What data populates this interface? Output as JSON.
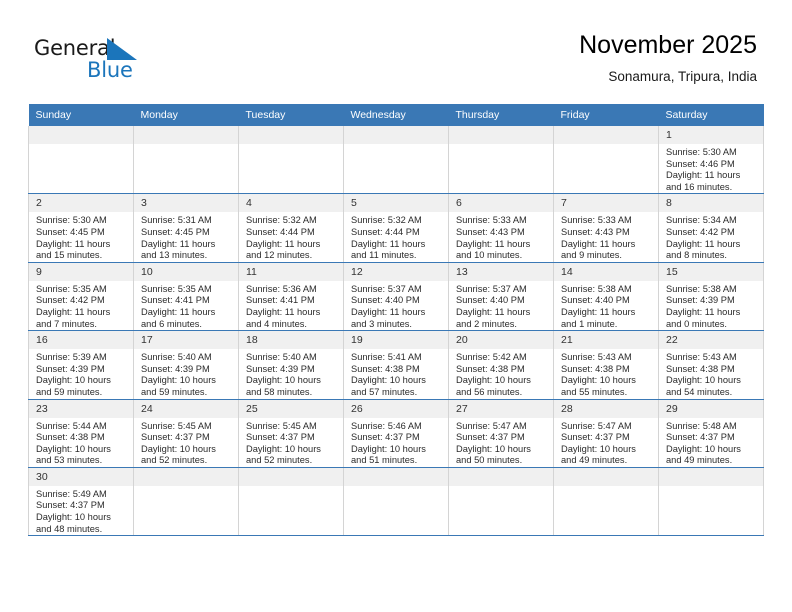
{
  "brand": {
    "name_part1": "General",
    "name_part2": "Blue",
    "logo_color": "#1b75bb"
  },
  "header": {
    "title": "November 2025",
    "subtitle": "Sonamura, Tripura, India"
  },
  "theme": {
    "header_bg": "#3a78b5",
    "daynum_bg": "#f0f0f0",
    "cell_border": "#d4d4d4",
    "text": "#2b2b2b"
  },
  "weekdays": [
    "Sunday",
    "Monday",
    "Tuesday",
    "Wednesday",
    "Thursday",
    "Friday",
    "Saturday"
  ],
  "weeks": [
    [
      {
        "day": "",
        "sunrise": "",
        "sunset": "",
        "daylight1": "",
        "daylight2": ""
      },
      {
        "day": "",
        "sunrise": "",
        "sunset": "",
        "daylight1": "",
        "daylight2": ""
      },
      {
        "day": "",
        "sunrise": "",
        "sunset": "",
        "daylight1": "",
        "daylight2": ""
      },
      {
        "day": "",
        "sunrise": "",
        "sunset": "",
        "daylight1": "",
        "daylight2": ""
      },
      {
        "day": "",
        "sunrise": "",
        "sunset": "",
        "daylight1": "",
        "daylight2": ""
      },
      {
        "day": "",
        "sunrise": "",
        "sunset": "",
        "daylight1": "",
        "daylight2": ""
      },
      {
        "day": "1",
        "sunrise": "Sunrise: 5:30 AM",
        "sunset": "Sunset: 4:46 PM",
        "daylight1": "Daylight: 11 hours",
        "daylight2": "and 16 minutes."
      }
    ],
    [
      {
        "day": "2",
        "sunrise": "Sunrise: 5:30 AM",
        "sunset": "Sunset: 4:45 PM",
        "daylight1": "Daylight: 11 hours",
        "daylight2": "and 15 minutes."
      },
      {
        "day": "3",
        "sunrise": "Sunrise: 5:31 AM",
        "sunset": "Sunset: 4:45 PM",
        "daylight1": "Daylight: 11 hours",
        "daylight2": "and 13 minutes."
      },
      {
        "day": "4",
        "sunrise": "Sunrise: 5:32 AM",
        "sunset": "Sunset: 4:44 PM",
        "daylight1": "Daylight: 11 hours",
        "daylight2": "and 12 minutes."
      },
      {
        "day": "5",
        "sunrise": "Sunrise: 5:32 AM",
        "sunset": "Sunset: 4:44 PM",
        "daylight1": "Daylight: 11 hours",
        "daylight2": "and 11 minutes."
      },
      {
        "day": "6",
        "sunrise": "Sunrise: 5:33 AM",
        "sunset": "Sunset: 4:43 PM",
        "daylight1": "Daylight: 11 hours",
        "daylight2": "and 10 minutes."
      },
      {
        "day": "7",
        "sunrise": "Sunrise: 5:33 AM",
        "sunset": "Sunset: 4:43 PM",
        "daylight1": "Daylight: 11 hours",
        "daylight2": "and 9 minutes."
      },
      {
        "day": "8",
        "sunrise": "Sunrise: 5:34 AM",
        "sunset": "Sunset: 4:42 PM",
        "daylight1": "Daylight: 11 hours",
        "daylight2": "and 8 minutes."
      }
    ],
    [
      {
        "day": "9",
        "sunrise": "Sunrise: 5:35 AM",
        "sunset": "Sunset: 4:42 PM",
        "daylight1": "Daylight: 11 hours",
        "daylight2": "and 7 minutes."
      },
      {
        "day": "10",
        "sunrise": "Sunrise: 5:35 AM",
        "sunset": "Sunset: 4:41 PM",
        "daylight1": "Daylight: 11 hours",
        "daylight2": "and 6 minutes."
      },
      {
        "day": "11",
        "sunrise": "Sunrise: 5:36 AM",
        "sunset": "Sunset: 4:41 PM",
        "daylight1": "Daylight: 11 hours",
        "daylight2": "and 4 minutes."
      },
      {
        "day": "12",
        "sunrise": "Sunrise: 5:37 AM",
        "sunset": "Sunset: 4:40 PM",
        "daylight1": "Daylight: 11 hours",
        "daylight2": "and 3 minutes."
      },
      {
        "day": "13",
        "sunrise": "Sunrise: 5:37 AM",
        "sunset": "Sunset: 4:40 PM",
        "daylight1": "Daylight: 11 hours",
        "daylight2": "and 2 minutes."
      },
      {
        "day": "14",
        "sunrise": "Sunrise: 5:38 AM",
        "sunset": "Sunset: 4:40 PM",
        "daylight1": "Daylight: 11 hours",
        "daylight2": "and 1 minute."
      },
      {
        "day": "15",
        "sunrise": "Sunrise: 5:38 AM",
        "sunset": "Sunset: 4:39 PM",
        "daylight1": "Daylight: 11 hours",
        "daylight2": "and 0 minutes."
      }
    ],
    [
      {
        "day": "16",
        "sunrise": "Sunrise: 5:39 AM",
        "sunset": "Sunset: 4:39 PM",
        "daylight1": "Daylight: 10 hours",
        "daylight2": "and 59 minutes."
      },
      {
        "day": "17",
        "sunrise": "Sunrise: 5:40 AM",
        "sunset": "Sunset: 4:39 PM",
        "daylight1": "Daylight: 10 hours",
        "daylight2": "and 59 minutes."
      },
      {
        "day": "18",
        "sunrise": "Sunrise: 5:40 AM",
        "sunset": "Sunset: 4:39 PM",
        "daylight1": "Daylight: 10 hours",
        "daylight2": "and 58 minutes."
      },
      {
        "day": "19",
        "sunrise": "Sunrise: 5:41 AM",
        "sunset": "Sunset: 4:38 PM",
        "daylight1": "Daylight: 10 hours",
        "daylight2": "and 57 minutes."
      },
      {
        "day": "20",
        "sunrise": "Sunrise: 5:42 AM",
        "sunset": "Sunset: 4:38 PM",
        "daylight1": "Daylight: 10 hours",
        "daylight2": "and 56 minutes."
      },
      {
        "day": "21",
        "sunrise": "Sunrise: 5:43 AM",
        "sunset": "Sunset: 4:38 PM",
        "daylight1": "Daylight: 10 hours",
        "daylight2": "and 55 minutes."
      },
      {
        "day": "22",
        "sunrise": "Sunrise: 5:43 AM",
        "sunset": "Sunset: 4:38 PM",
        "daylight1": "Daylight: 10 hours",
        "daylight2": "and 54 minutes."
      }
    ],
    [
      {
        "day": "23",
        "sunrise": "Sunrise: 5:44 AM",
        "sunset": "Sunset: 4:38 PM",
        "daylight1": "Daylight: 10 hours",
        "daylight2": "and 53 minutes."
      },
      {
        "day": "24",
        "sunrise": "Sunrise: 5:45 AM",
        "sunset": "Sunset: 4:37 PM",
        "daylight1": "Daylight: 10 hours",
        "daylight2": "and 52 minutes."
      },
      {
        "day": "25",
        "sunrise": "Sunrise: 5:45 AM",
        "sunset": "Sunset: 4:37 PM",
        "daylight1": "Daylight: 10 hours",
        "daylight2": "and 52 minutes."
      },
      {
        "day": "26",
        "sunrise": "Sunrise: 5:46 AM",
        "sunset": "Sunset: 4:37 PM",
        "daylight1": "Daylight: 10 hours",
        "daylight2": "and 51 minutes."
      },
      {
        "day": "27",
        "sunrise": "Sunrise: 5:47 AM",
        "sunset": "Sunset: 4:37 PM",
        "daylight1": "Daylight: 10 hours",
        "daylight2": "and 50 minutes."
      },
      {
        "day": "28",
        "sunrise": "Sunrise: 5:47 AM",
        "sunset": "Sunset: 4:37 PM",
        "daylight1": "Daylight: 10 hours",
        "daylight2": "and 49 minutes."
      },
      {
        "day": "29",
        "sunrise": "Sunrise: 5:48 AM",
        "sunset": "Sunset: 4:37 PM",
        "daylight1": "Daylight: 10 hours",
        "daylight2": "and 49 minutes."
      }
    ],
    [
      {
        "day": "30",
        "sunrise": "Sunrise: 5:49 AM",
        "sunset": "Sunset: 4:37 PM",
        "daylight1": "Daylight: 10 hours",
        "daylight2": "and 48 minutes."
      },
      {
        "day": "",
        "sunrise": "",
        "sunset": "",
        "daylight1": "",
        "daylight2": ""
      },
      {
        "day": "",
        "sunrise": "",
        "sunset": "",
        "daylight1": "",
        "daylight2": ""
      },
      {
        "day": "",
        "sunrise": "",
        "sunset": "",
        "daylight1": "",
        "daylight2": ""
      },
      {
        "day": "",
        "sunrise": "",
        "sunset": "",
        "daylight1": "",
        "daylight2": ""
      },
      {
        "day": "",
        "sunrise": "",
        "sunset": "",
        "daylight1": "",
        "daylight2": ""
      },
      {
        "day": "",
        "sunrise": "",
        "sunset": "",
        "daylight1": "",
        "daylight2": ""
      }
    ]
  ]
}
